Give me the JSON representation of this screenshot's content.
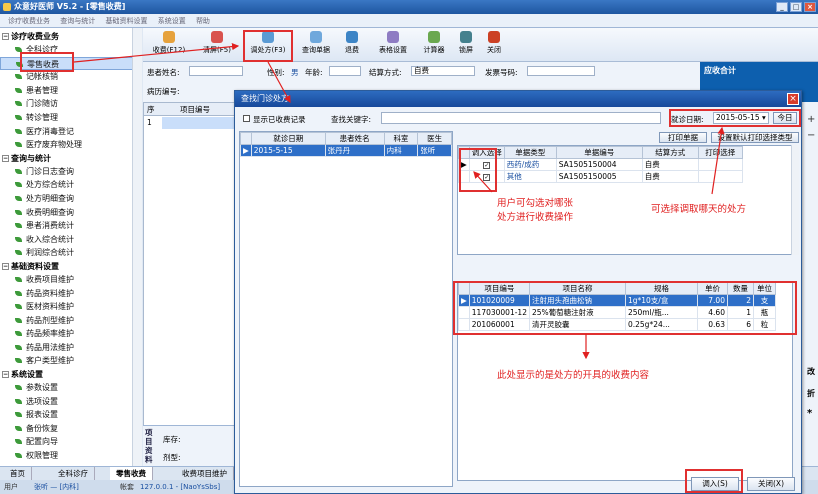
{
  "app": {
    "title": "众意好医师 V5.2 - [零售收费]"
  },
  "menu": [
    "诊疗收费业务",
    "查询与统计",
    "基础资料设置",
    "系统设置",
    "帮助"
  ],
  "sidebar": {
    "groups": [
      {
        "title": "诊疗收费业务",
        "items": [
          "全科诊疗",
          "零售收费",
          "记帐核销",
          "患者管理",
          "门诊随访",
          "转诊管理",
          "医疗消毒登记",
          "医疗废弃物处理"
        ]
      },
      {
        "title": "查询与统计",
        "items": [
          "门诊日志查询",
          "处方综合统计",
          "处方明细查询",
          "收费明细查询",
          "患者消费统计",
          "收入综合统计",
          "利润综合统计"
        ]
      },
      {
        "title": "基础资料设置",
        "items": [
          "收费项目维护",
          "药品资料维护",
          "医材资料维护",
          "药品剂型维护",
          "药品频率维护",
          "药品用法维护",
          "客户类型维护"
        ]
      },
      {
        "title": "系统设置",
        "items": [
          "参数设置",
          "选项设置",
          "报表设置",
          "备份恢复",
          "配置向导",
          "权限管理"
        ]
      }
    ]
  },
  "toolbar": [
    "收费(F12)",
    "清屏(F5)",
    "调处方(F3)",
    "查询单据",
    "退费",
    "表格设置",
    "计算器",
    "锁屏",
    "关闭"
  ],
  "form": {
    "patient_name_label": "患者姓名:",
    "gender_label": "性别:",
    "gender_value": "男",
    "age_label": "年龄:",
    "settle_label": "结算方式:",
    "settle_value": "自费",
    "invoice_label": "发票号码:",
    "record_label": "病历编号:",
    "receivable_label": "应收合计"
  },
  "left_grid": {
    "headers": [
      "序",
      "项目编号"
    ],
    "row_no": "1"
  },
  "bottom_pane": {
    "vertical_label": "项目资料",
    "stock_label": "库存:",
    "form_label": "剂型:"
  },
  "tabs": [
    "首页",
    "全科诊疗",
    "零售收费",
    "收费项目维护"
  ],
  "status": {
    "user_label": "用户",
    "user_value": "张听 — [内科]",
    "account_label": "帐套",
    "account_value": "127.0.0.1 - [NaoYsSbs]"
  },
  "dialog": {
    "title": "查找门诊处方",
    "show_charged": "显示已收费记录",
    "search_label": "查找关键字:",
    "date_label": "就诊日期:",
    "date_value": "2015-05-15",
    "today_btn": "今日",
    "print_btn": "打印单据",
    "set_default_btn": "设置默认打印选择类型",
    "left_headers": [
      "就诊日期",
      "患者姓名",
      "科室",
      "医生"
    ],
    "left_rows": [
      [
        "2015-5-15",
        "张丹丹",
        "内科",
        "张听"
      ]
    ],
    "pres_headers": [
      "调入选择",
      "单据类型",
      "单据编号",
      "结算方式",
      "打印选择"
    ],
    "pres_rows": [
      [
        "西药/成药",
        "SA1505150004",
        "自费"
      ],
      [
        "其他",
        "SA1505150005",
        "自费"
      ]
    ],
    "item_headers": [
      "项目编号",
      "项目名称",
      "规格",
      "单价",
      "数量",
      "单位"
    ],
    "item_rows": [
      [
        "101020009",
        "注射用头孢曲松钠",
        "1g*10支/盒",
        "7.00",
        "2",
        "支"
      ],
      [
        "117030001-12",
        "25%葡萄糖注射液",
        "250ml/瓶...",
        "4.60",
        "1",
        "瓶"
      ],
      [
        "201060001",
        "清开灵胶囊",
        "0.25g*24...",
        "0.63",
        "6",
        "粒"
      ]
    ],
    "load_btn": "调入(S)",
    "close_btn": "关闭(X)"
  },
  "annotations": {
    "select_note": [
      "用户可勾选对哪张",
      "处方进行收费操作"
    ],
    "date_note": "可选择调取哪天的处方",
    "items_note": "此处显示的是处方的开具的收费内容"
  },
  "right_strip": [
    "改",
    "折"
  ],
  "colors": {
    "accent": "#2e6fc8",
    "annotation": "#e02020",
    "receivable_bg": "#0d5fae"
  }
}
